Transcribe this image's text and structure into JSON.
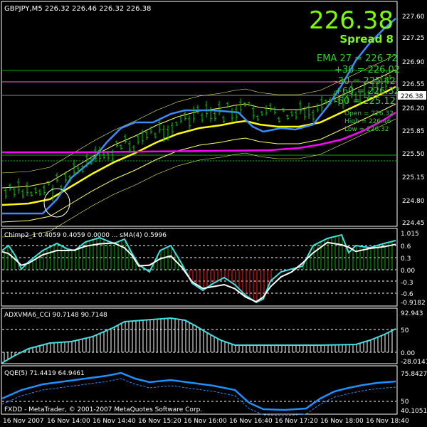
{
  "colors": {
    "background": "#000000",
    "frame": "#ffffff",
    "grid": "#ffffff",
    "candle": "#00c800",
    "price_big": "#7cfc00",
    "annot": "#32cd32",
    "env_outer": "#ffff66",
    "env_inner": "#ffff00",
    "ma_blue": "#3c8cff",
    "ma_magenta": "#ff00ff",
    "hline_green": "#00b000",
    "hline_pink": "#ff66cc",
    "cyan": "#40e0e0",
    "white": "#ffffff",
    "red": "#ff2020",
    "qqe_blue": "#1e90ff"
  },
  "main": {
    "symbol_line": "GBPJPY,M5  226.32 226.46 226.32 226.38",
    "big_price": "226.38",
    "spread_label": "Spread 8",
    "price_tag": "226.38",
    "annotations": {
      "ema": "EMA 27 = 226.72",
      "p30": "+30 = 226.02",
      "m30": "-30 = 225.42",
      "p60": "+60 = 226.32",
      "m60": "-60 = 225.12",
      "open": "Open = 226.32",
      "high": "High = 226.46",
      "low": "Low = 226.32"
    },
    "y_ticks": [
      "227.60",
      "227.25",
      "226.90",
      "226.55",
      "226.20",
      "225.85",
      "225.50",
      "225.15",
      "224.80",
      "224.45"
    ]
  },
  "chimp": {
    "label": "Chimp2_1 0.4059 0.4059 0.0000 ... sMA(4) 0.5996",
    "y_ticks": [
      "1.015",
      "0.6",
      "0.3",
      "0.00",
      "-0.3",
      "-0.6",
      "-0.9182"
    ]
  },
  "adx": {
    "label": "ADXVMA6_CCi 90.7148 90.7148",
    "y_ticks": [
      "92.943",
      "50",
      "0.00",
      "-28.0141"
    ]
  },
  "qqe": {
    "label": "QQE(5) 71.4419 64.9461",
    "y_ticks": [
      "75.8427",
      "50",
      "40.1051"
    ]
  },
  "copyright": "FXDD - MetaTrader, © 2001-2007 MetaQuotes Software Corp.",
  "x_ticks": [
    "16 Nov 2007",
    "16 Nov 14:00",
    "16 Nov 14:40",
    "16 Nov 15:20",
    "16 Nov 16:00",
    "16 Nov 16:40",
    "16 Nov 17:20",
    "16 Nov 18:00",
    "16 Nov 18:40"
  ]
}
